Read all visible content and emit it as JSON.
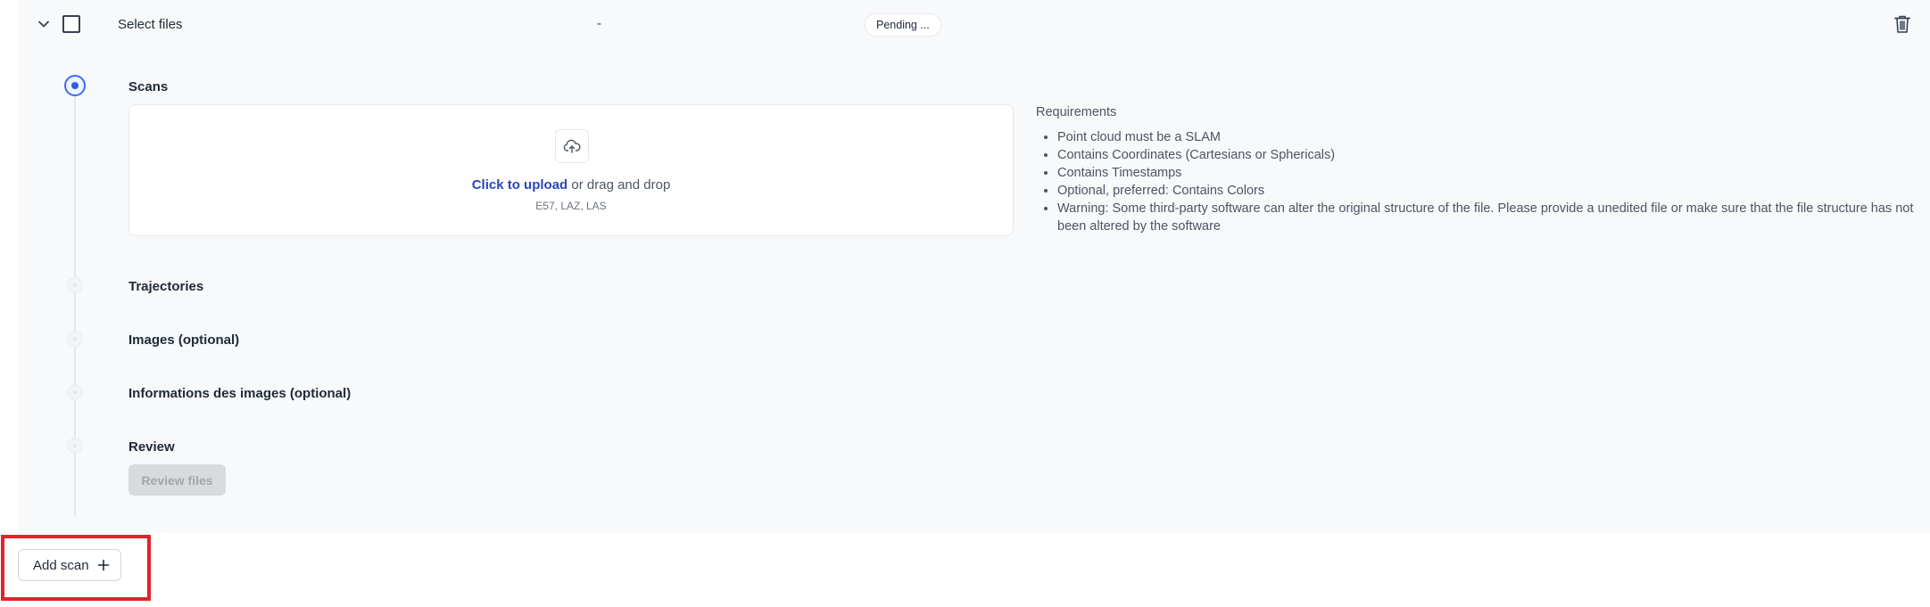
{
  "file_row": {
    "title": "Select files",
    "dash": "-",
    "status": "Pending ..."
  },
  "steps": [
    {
      "label": "Scans",
      "state": "active"
    },
    {
      "label": "Trajectories",
      "state": "pending"
    },
    {
      "label": "Images (optional)",
      "state": "pending"
    },
    {
      "label": "Informations des images (optional)",
      "state": "pending"
    },
    {
      "label": "Review",
      "state": "pending"
    }
  ],
  "upload": {
    "link_text": "Click to upload",
    "rest_text": " or drag and drop",
    "formats": "E57, LAZ, LAS"
  },
  "requirements": {
    "title": "Requirements",
    "items": [
      "Point cloud must be a SLAM",
      "Contains Coordinates (Cartesians or Sphericals)",
      "Contains Timestamps",
      "Optional, preferred: Contains Colors",
      "Warning: Some third-party software can alter the original structure of the file. Please provide a unedited file or make sure that the file structure has not been altered by the software"
    ]
  },
  "review_button": {
    "label": "Review files",
    "disabled": true
  },
  "add_scan_button": {
    "label": "Add scan",
    "icon": "plus-icon"
  },
  "icons": {
    "expand": "chevron-down-icon",
    "select": "checkbox",
    "delete": "trash-icon",
    "upload": "cloud-upload-icon"
  },
  "colors": {
    "accent": "#2f5fe8",
    "link": "#2747b8",
    "highlight": "#e0242a",
    "panel_bg": "#f8f9fb"
  }
}
